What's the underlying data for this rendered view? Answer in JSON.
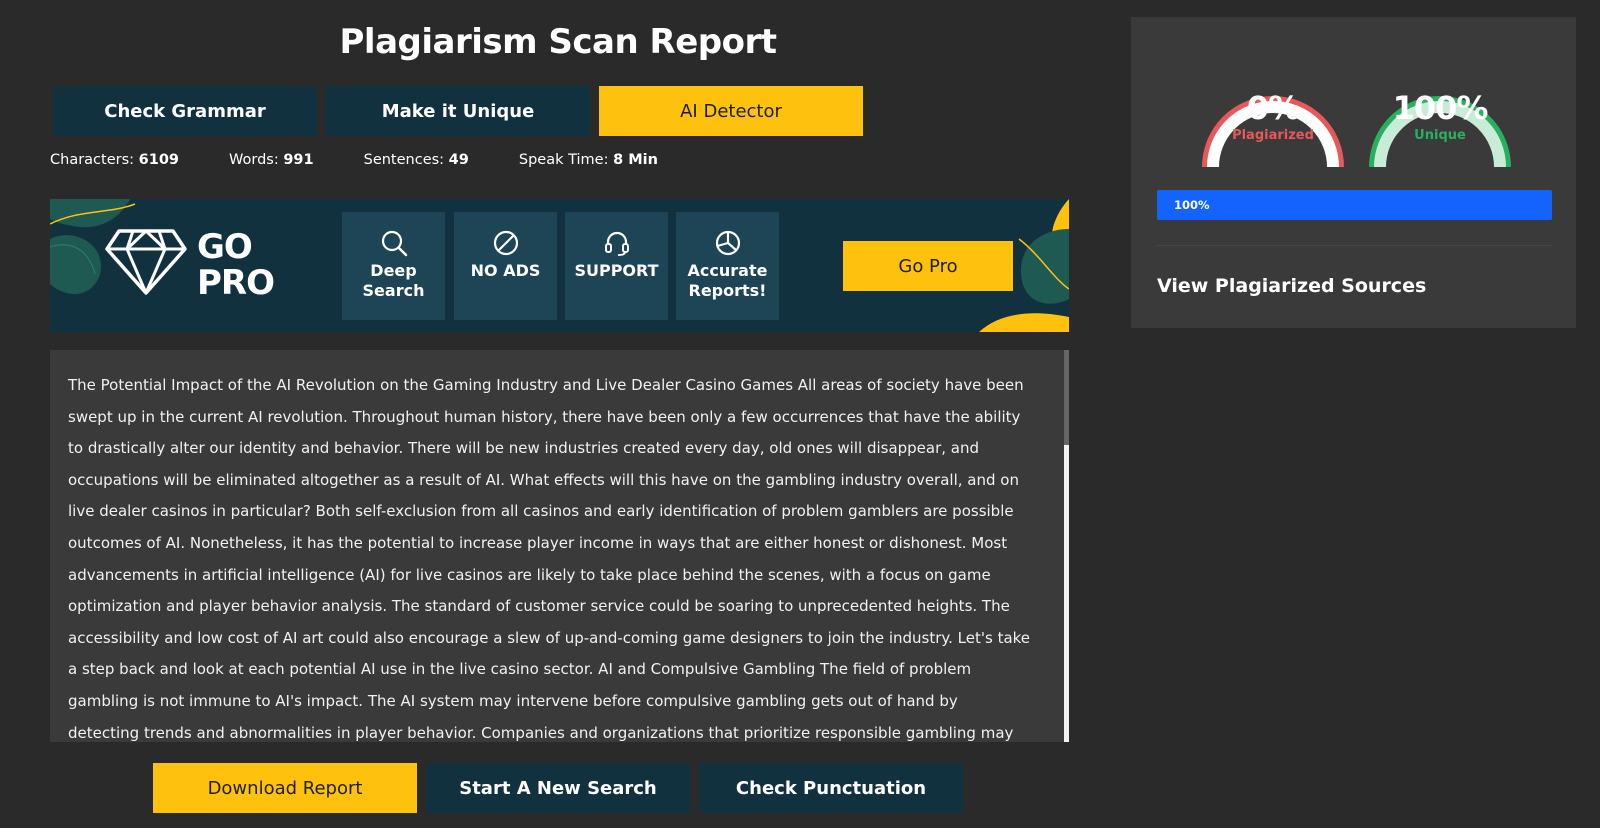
{
  "header": {
    "title": "Plagiarism Scan Report"
  },
  "tools": {
    "check_grammar": "Check Grammar",
    "make_unique": "Make it Unique",
    "ai_detector": "AI Detector"
  },
  "stats": {
    "characters_label": "Characters:",
    "characters_value": "6109",
    "words_label": "Words:",
    "words_value": "991",
    "sentences_label": "Sentences:",
    "sentences_value": "49",
    "speak_label": "Speak Time:",
    "speak_value": "8 Min"
  },
  "promo": {
    "go": "GO",
    "pro": "PRO",
    "features": [
      {
        "line1": "Deep",
        "line2": "Search",
        "icon": "search-icon"
      },
      {
        "line1": "NO ADS",
        "line2": "",
        "icon": "no-ads-icon"
      },
      {
        "line1": "SUPPORT",
        "line2": "",
        "icon": "headset-icon"
      },
      {
        "line1": "Accurate",
        "line2": "Reports!",
        "icon": "pie-chart-icon"
      }
    ],
    "button": "Go Pro",
    "colors": {
      "accent": "#fec20e",
      "leaf": "#1e5a52",
      "panel": "#12313f"
    }
  },
  "document": {
    "text": "The Potential Impact of the AI Revolution on the Gaming Industry and Live Dealer Casino Games All areas of society have been swept up in the current AI revolution. Throughout human history, there have been only a few occurrences that have the ability to drastically alter our identity and behavior. There will be new industries created every day, old ones will disappear, and occupations will be eliminated altogether as a result of AI. What effects will this have on the gambling industry overall, and on live dealer casinos in particular? Both self-exclusion from all casinos and early identification of problem gamblers are possible outcomes of AI. Nonetheless, it has the potential to increase player income in ways that are either honest or dishonest. Most advancements in artificial intelligence (AI) for live casinos are likely to take place behind the scenes, with a focus on game optimization and player behavior analysis. The standard of customer service could be soaring to unprecedented heights. The accessibility and low cost of AI art could also encourage a slew of up-and-coming game designers to join the industry. Let's take a step back and look at each potential AI use in the live casino sector. AI and Compulsive Gambling The field of problem gambling is not immune to AI's impact. The AI system may intervene before compulsive gambling gets out of hand by detecting trends and abnormalities in player behavior. Companies and organizations that prioritize responsible gambling may"
  },
  "actions": {
    "download": "Download Report",
    "new_search": "Start A New Search",
    "punctuation": "Check Punctuation"
  },
  "results": {
    "plagiarized_pct": "0%",
    "plagiarized_label": "Plagiarized",
    "plagiarized_color": "#e8585a",
    "unique_pct": "100%",
    "unique_label": "Unique",
    "unique_color": "#27b15e",
    "progress_value": 100,
    "progress_text": "100%",
    "progress_color": "#1463fc",
    "sources_link": "View Plagiarized Sources"
  }
}
